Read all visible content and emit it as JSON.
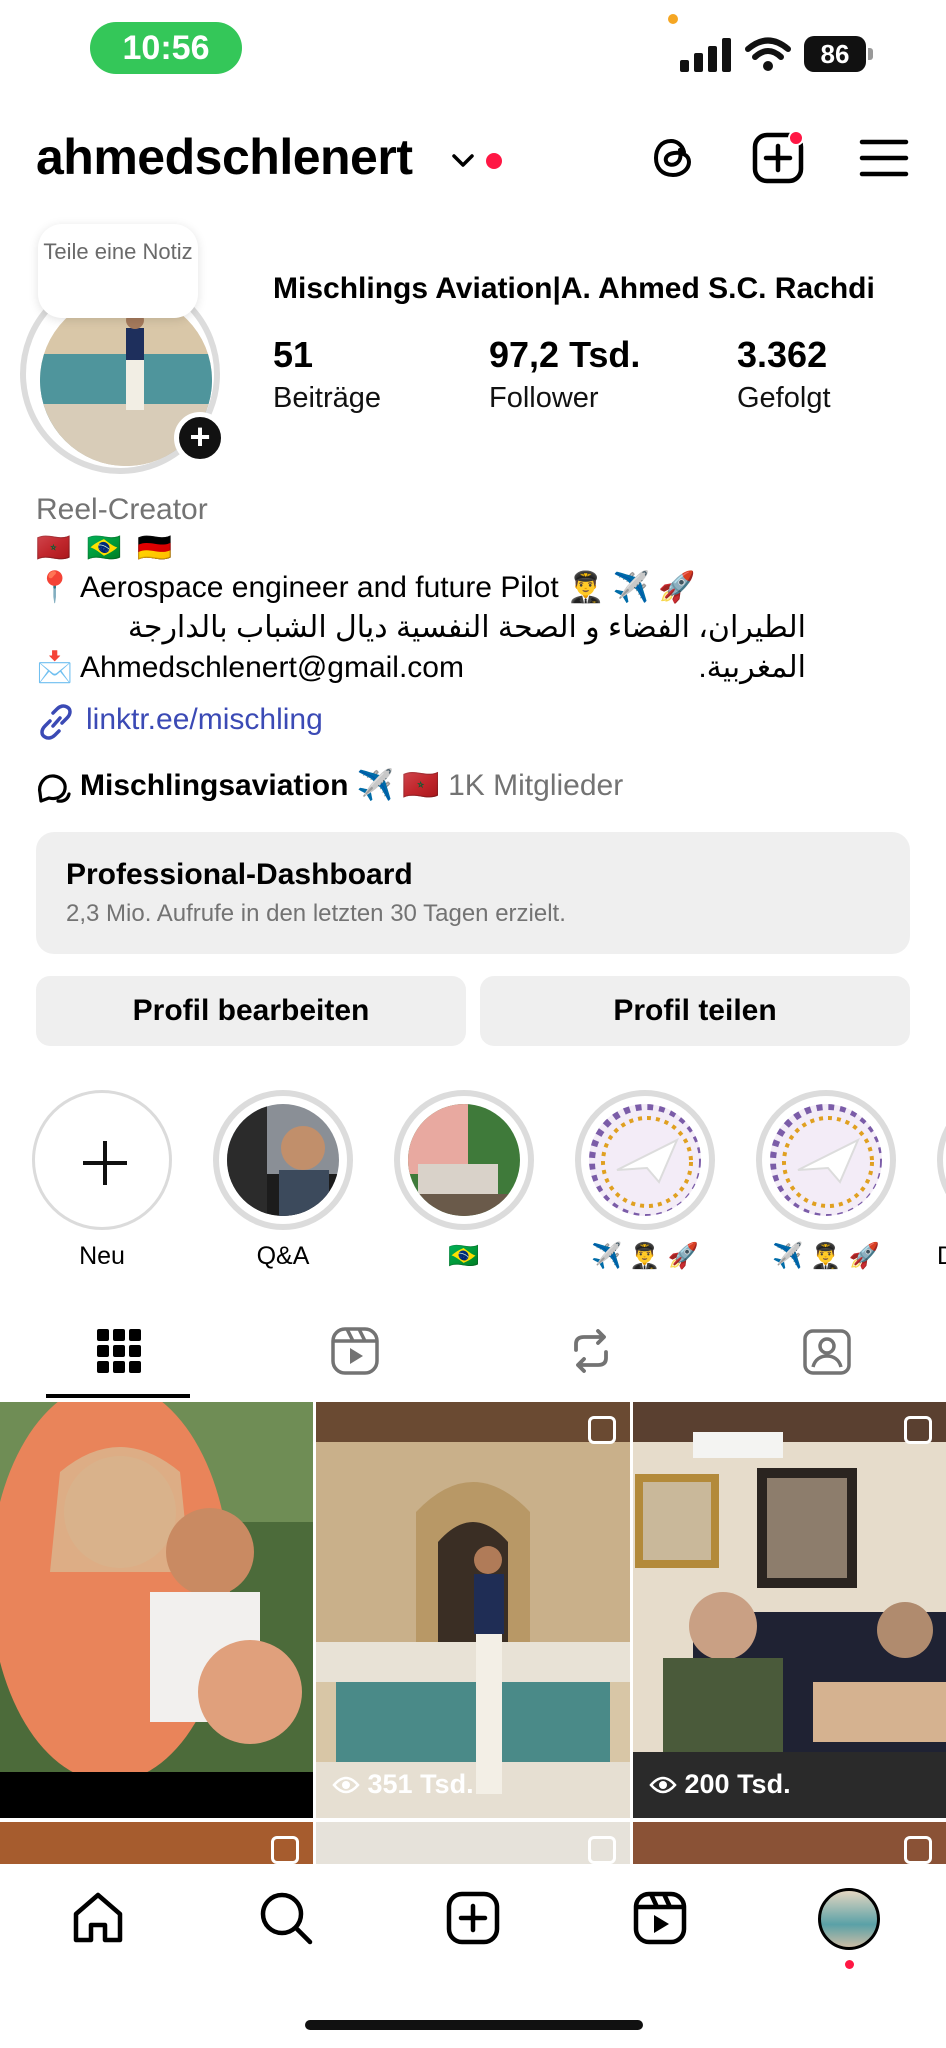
{
  "status_bar": {
    "time": "10:56",
    "battery": "86"
  },
  "header": {
    "username": "ahmedschlenert"
  },
  "profile": {
    "note_text": "Teile eine Notiz",
    "display_name": "Mischlings Aviation|A. Ahmed S.C. Rachdi",
    "stats": [
      {
        "value": "51",
        "label": "Beiträge"
      },
      {
        "value": "97,2 Tsd.",
        "label": "Follower"
      },
      {
        "value": "3.362",
        "label": "Gefolgt"
      }
    ],
    "category": "Reel-Creator",
    "flags": "🇲🇦 🇧🇷 🇩🇪",
    "bio_line1": "📍 Aerospace engineer and future Pilot 👨‍✈️ ✈️ 🚀",
    "bio_line2": "الطيران، الفضاء و الصحة النفسية ديال الشباب بالدارجة المغربية.",
    "bio_line3": "📩 Ahmedschlenert@gmail.com",
    "link": "linktr.ee/mischling",
    "channel_name": "Mischlingsaviation ✈️ 🇲🇦",
    "channel_members": "1K Mitglieder"
  },
  "dashboard": {
    "title": "Professional-Dashboard",
    "subtitle": "2,3 Mio. Aufrufe in den letzten 30 Tagen erzielt."
  },
  "buttons": {
    "edit": "Profil bearbeiten",
    "share": "Profil teilen"
  },
  "highlights": [
    {
      "label": "Neu"
    },
    {
      "label": "Q&A"
    },
    {
      "label": "🇧🇷"
    },
    {
      "label": "✈️ 👨‍✈️ 🚀"
    },
    {
      "label": "✈️ 👨‍✈️ 🚀"
    },
    {
      "label": "D"
    }
  ],
  "grid": [
    {
      "views": ""
    },
    {
      "views": "351 Tsd."
    },
    {
      "views": "200 Tsd."
    }
  ],
  "colors": {
    "accent_red": "#ff1744",
    "status_green": "#34c759",
    "link_blue": "#3b4ab5",
    "muted": "#737373"
  }
}
